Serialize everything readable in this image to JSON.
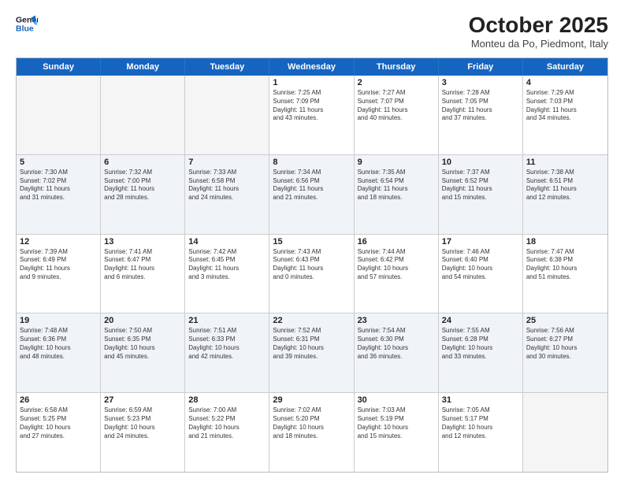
{
  "header": {
    "logo_line1": "General",
    "logo_line2": "Blue",
    "month": "October 2025",
    "location": "Monteu da Po, Piedmont, Italy"
  },
  "days_of_week": [
    "Sunday",
    "Monday",
    "Tuesday",
    "Wednesday",
    "Thursday",
    "Friday",
    "Saturday"
  ],
  "weeks": [
    [
      {
        "day": "",
        "info": ""
      },
      {
        "day": "",
        "info": ""
      },
      {
        "day": "",
        "info": ""
      },
      {
        "day": "1",
        "info": "Sunrise: 7:25 AM\nSunset: 7:09 PM\nDaylight: 11 hours\nand 43 minutes."
      },
      {
        "day": "2",
        "info": "Sunrise: 7:27 AM\nSunset: 7:07 PM\nDaylight: 11 hours\nand 40 minutes."
      },
      {
        "day": "3",
        "info": "Sunrise: 7:28 AM\nSunset: 7:05 PM\nDaylight: 11 hours\nand 37 minutes."
      },
      {
        "day": "4",
        "info": "Sunrise: 7:29 AM\nSunset: 7:03 PM\nDaylight: 11 hours\nand 34 minutes."
      }
    ],
    [
      {
        "day": "5",
        "info": "Sunrise: 7:30 AM\nSunset: 7:02 PM\nDaylight: 11 hours\nand 31 minutes."
      },
      {
        "day": "6",
        "info": "Sunrise: 7:32 AM\nSunset: 7:00 PM\nDaylight: 11 hours\nand 28 minutes."
      },
      {
        "day": "7",
        "info": "Sunrise: 7:33 AM\nSunset: 6:58 PM\nDaylight: 11 hours\nand 24 minutes."
      },
      {
        "day": "8",
        "info": "Sunrise: 7:34 AM\nSunset: 6:56 PM\nDaylight: 11 hours\nand 21 minutes."
      },
      {
        "day": "9",
        "info": "Sunrise: 7:35 AM\nSunset: 6:54 PM\nDaylight: 11 hours\nand 18 minutes."
      },
      {
        "day": "10",
        "info": "Sunrise: 7:37 AM\nSunset: 6:52 PM\nDaylight: 11 hours\nand 15 minutes."
      },
      {
        "day": "11",
        "info": "Sunrise: 7:38 AM\nSunset: 6:51 PM\nDaylight: 11 hours\nand 12 minutes."
      }
    ],
    [
      {
        "day": "12",
        "info": "Sunrise: 7:39 AM\nSunset: 6:49 PM\nDaylight: 11 hours\nand 9 minutes."
      },
      {
        "day": "13",
        "info": "Sunrise: 7:41 AM\nSunset: 6:47 PM\nDaylight: 11 hours\nand 6 minutes."
      },
      {
        "day": "14",
        "info": "Sunrise: 7:42 AM\nSunset: 6:45 PM\nDaylight: 11 hours\nand 3 minutes."
      },
      {
        "day": "15",
        "info": "Sunrise: 7:43 AM\nSunset: 6:43 PM\nDaylight: 11 hours\nand 0 minutes."
      },
      {
        "day": "16",
        "info": "Sunrise: 7:44 AM\nSunset: 6:42 PM\nDaylight: 10 hours\nand 57 minutes."
      },
      {
        "day": "17",
        "info": "Sunrise: 7:46 AM\nSunset: 6:40 PM\nDaylight: 10 hours\nand 54 minutes."
      },
      {
        "day": "18",
        "info": "Sunrise: 7:47 AM\nSunset: 6:38 PM\nDaylight: 10 hours\nand 51 minutes."
      }
    ],
    [
      {
        "day": "19",
        "info": "Sunrise: 7:48 AM\nSunset: 6:36 PM\nDaylight: 10 hours\nand 48 minutes."
      },
      {
        "day": "20",
        "info": "Sunrise: 7:50 AM\nSunset: 6:35 PM\nDaylight: 10 hours\nand 45 minutes."
      },
      {
        "day": "21",
        "info": "Sunrise: 7:51 AM\nSunset: 6:33 PM\nDaylight: 10 hours\nand 42 minutes."
      },
      {
        "day": "22",
        "info": "Sunrise: 7:52 AM\nSunset: 6:31 PM\nDaylight: 10 hours\nand 39 minutes."
      },
      {
        "day": "23",
        "info": "Sunrise: 7:54 AM\nSunset: 6:30 PM\nDaylight: 10 hours\nand 36 minutes."
      },
      {
        "day": "24",
        "info": "Sunrise: 7:55 AM\nSunset: 6:28 PM\nDaylight: 10 hours\nand 33 minutes."
      },
      {
        "day": "25",
        "info": "Sunrise: 7:56 AM\nSunset: 6:27 PM\nDaylight: 10 hours\nand 30 minutes."
      }
    ],
    [
      {
        "day": "26",
        "info": "Sunrise: 6:58 AM\nSunset: 5:25 PM\nDaylight: 10 hours\nand 27 minutes."
      },
      {
        "day": "27",
        "info": "Sunrise: 6:59 AM\nSunset: 5:23 PM\nDaylight: 10 hours\nand 24 minutes."
      },
      {
        "day": "28",
        "info": "Sunrise: 7:00 AM\nSunset: 5:22 PM\nDaylight: 10 hours\nand 21 minutes."
      },
      {
        "day": "29",
        "info": "Sunrise: 7:02 AM\nSunset: 5:20 PM\nDaylight: 10 hours\nand 18 minutes."
      },
      {
        "day": "30",
        "info": "Sunrise: 7:03 AM\nSunset: 5:19 PM\nDaylight: 10 hours\nand 15 minutes."
      },
      {
        "day": "31",
        "info": "Sunrise: 7:05 AM\nSunset: 5:17 PM\nDaylight: 10 hours\nand 12 minutes."
      },
      {
        "day": "",
        "info": ""
      }
    ]
  ]
}
